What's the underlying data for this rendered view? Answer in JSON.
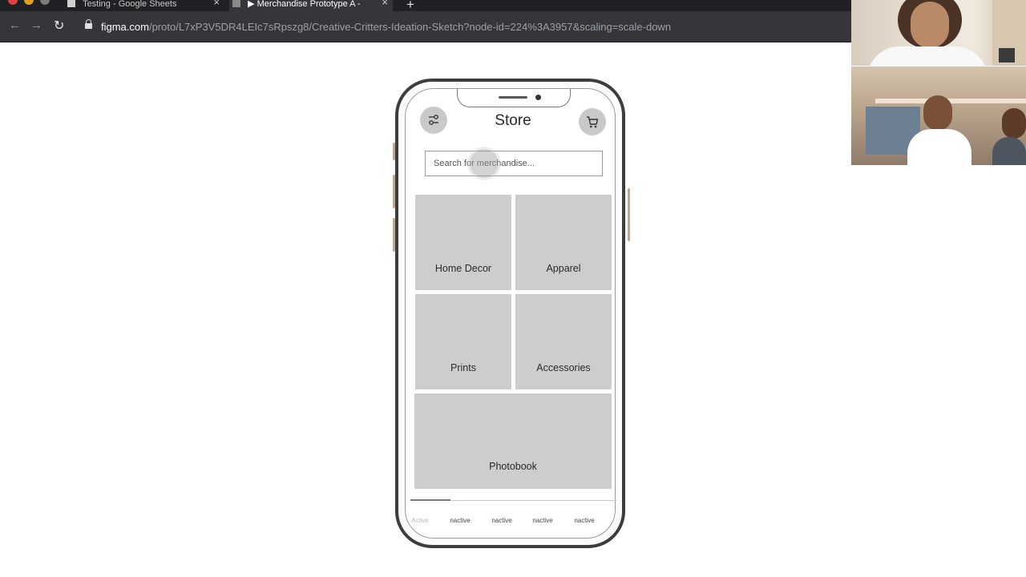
{
  "browser": {
    "tabs": [
      {
        "title": "Testing - Google Sheets",
        "active": false
      },
      {
        "title": "▶ Merchandise Prototype A -",
        "active": true
      }
    ],
    "url_host": "figma.com",
    "url_path": "/proto/L7xP3V5DR4LEIc7sRpszg8/Creative-Critters-Ideation-Sketch?node-id=224%3A3957&scaling=scale-down"
  },
  "app": {
    "title": "Store",
    "search_placeholder": "Search for merchandise...",
    "categories": [
      "Home Decor",
      "Apparel",
      "Prints",
      "Accessories",
      "Photobook"
    ],
    "tabbar": [
      {
        "label": "Active",
        "active": true
      },
      {
        "label": "nactive",
        "active": false
      },
      {
        "label": "nactive",
        "active": false
      },
      {
        "label": "nactive",
        "active": false
      },
      {
        "label": "nactive",
        "active": false
      }
    ]
  },
  "colors": {
    "tile_gray": "#cdcdcd",
    "icon_button_gray": "#c9c9c9",
    "browser_chrome": "#35363a",
    "phone_frame": "#3d3d3d"
  },
  "icons": [
    "filter-sliders-icon",
    "shopping-cart-icon",
    "back-arrow-icon",
    "forward-arrow-icon",
    "reload-icon",
    "lock-icon"
  ]
}
